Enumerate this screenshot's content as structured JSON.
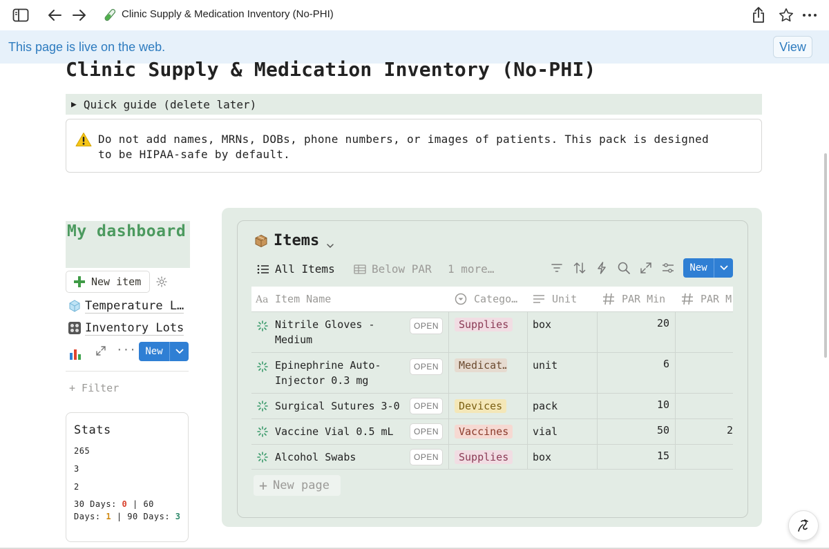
{
  "browser": {
    "tab_title": "Clinic Supply & Medication Inventory (No-PHI)",
    "live_banner": "This page is live on the web.",
    "view_label": "View"
  },
  "page": {
    "title": "Clinic Supply & Medication Inventory (No-PHI)",
    "toggle_label": "Quick guide (delete later)",
    "callout_text": "Do not add names, MRNs, DOBs, phone numbers, or images of patients. This pack is designed to be HIPAA-safe by default."
  },
  "dashboard": {
    "heading": "My dashboard",
    "new_item_label": "New item",
    "links": [
      "Temperature L…",
      "Inventory Lots"
    ],
    "new_label": "New",
    "filter_label": "+ Filter"
  },
  "stats": {
    "title": "Stats",
    "line1": "265",
    "line2": "3",
    "line3": "2",
    "d30_prefix": "30 Days: ",
    "d30_val": "0",
    "d60_prefix": " | 60 Days: ",
    "d60_val": "1",
    "d90_prefix": " | 90 Days: ",
    "d90_val": "3"
  },
  "database": {
    "title": "Items",
    "views": [
      "All Items",
      "Below PAR",
      "1 more…"
    ],
    "new_label": "New",
    "columns": [
      "Item Name",
      "Catego…",
      "Unit",
      "PAR Min",
      "PAR M"
    ],
    "open_label": "OPEN",
    "rows": [
      {
        "name": "Nitrile Gloves - Medium",
        "category": "Supplies",
        "unit": "box",
        "par_min": "20",
        "par_max": ""
      },
      {
        "name": "Epinephrine Auto-Injector 0.3 mg",
        "category": "Medicat…",
        "unit": "unit",
        "par_min": "6",
        "par_max": ""
      },
      {
        "name": "Surgical Sutures 3-0",
        "category": "Devices",
        "unit": "pack",
        "par_min": "10",
        "par_max": ""
      },
      {
        "name": "Vaccine Vial 0.5 mL",
        "category": "Vaccines",
        "unit": "vial",
        "par_min": "50",
        "par_max": "2"
      },
      {
        "name": "Alcohol Swabs",
        "category": "Supplies",
        "unit": "box",
        "par_min": "15",
        "par_max": ""
      }
    ],
    "new_page_label": "New page",
    "category_colors": {
      "Supplies": "#f1dde3",
      "Medication": "#e6dbd0",
      "Devices": "#f4e7b8",
      "Vaccines": "#f6d9d2"
    }
  },
  "colors": {
    "accent_blue": "#2f7fd4",
    "dashboard_green": "#4c9a5f",
    "panel_bg": "#e3ece5",
    "banner_bg": "#e7f1fa"
  }
}
